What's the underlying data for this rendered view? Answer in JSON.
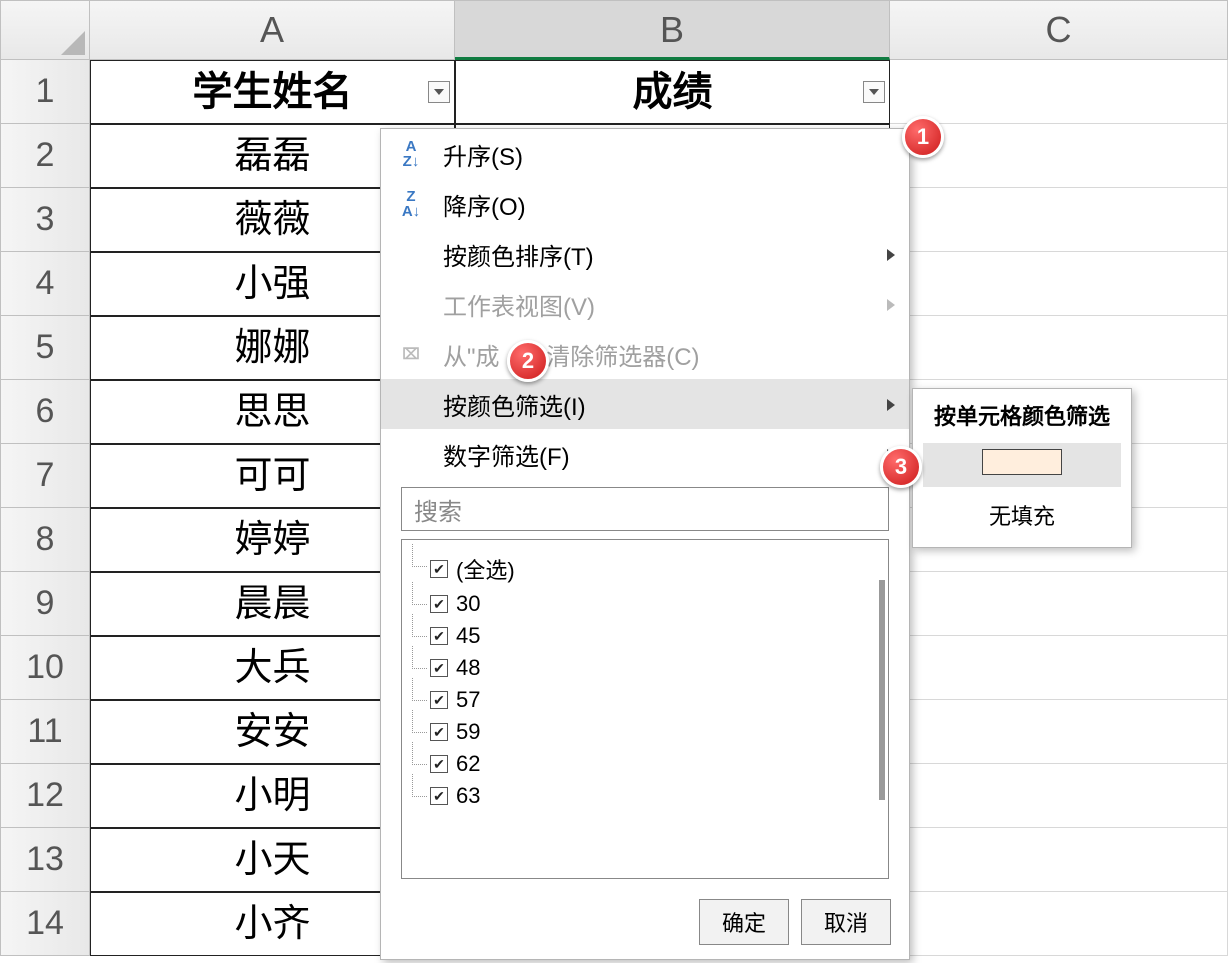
{
  "columns": {
    "A": "A",
    "B": "B",
    "C": "C"
  },
  "headers": {
    "name": "学生姓名",
    "score": "成绩"
  },
  "students": [
    "磊磊",
    "薇薇",
    "小强",
    "娜娜",
    "思思",
    "可可",
    "婷婷",
    "晨晨",
    "大兵",
    "安安",
    "小明",
    "小天",
    "小齐"
  ],
  "menu": {
    "sort_asc": "升序(S)",
    "sort_desc": "降序(O)",
    "sort_color": "按颜色排序(T)",
    "sheet_view": "工作表视图(V)",
    "clear_filter_prefix": "从\"成",
    "clear_filter_suffix": "清除筛选器(C)",
    "filter_color": "按颜色筛选(I)",
    "number_filter": "数字筛选(F)",
    "search_placeholder": "搜索",
    "ok": "确定",
    "cancel": "取消",
    "items": [
      "(全选)",
      "30",
      "45",
      "48",
      "57",
      "59",
      "62",
      "63"
    ]
  },
  "submenu": {
    "title": "按单元格颜色筛选",
    "no_fill": "无填充"
  },
  "badges": {
    "b1": "1",
    "b2": "2",
    "b3": "3"
  },
  "icons": {
    "az": "A↓\nZ",
    "za": "Z↓\nA",
    "funnel": "�filterClear"
  }
}
